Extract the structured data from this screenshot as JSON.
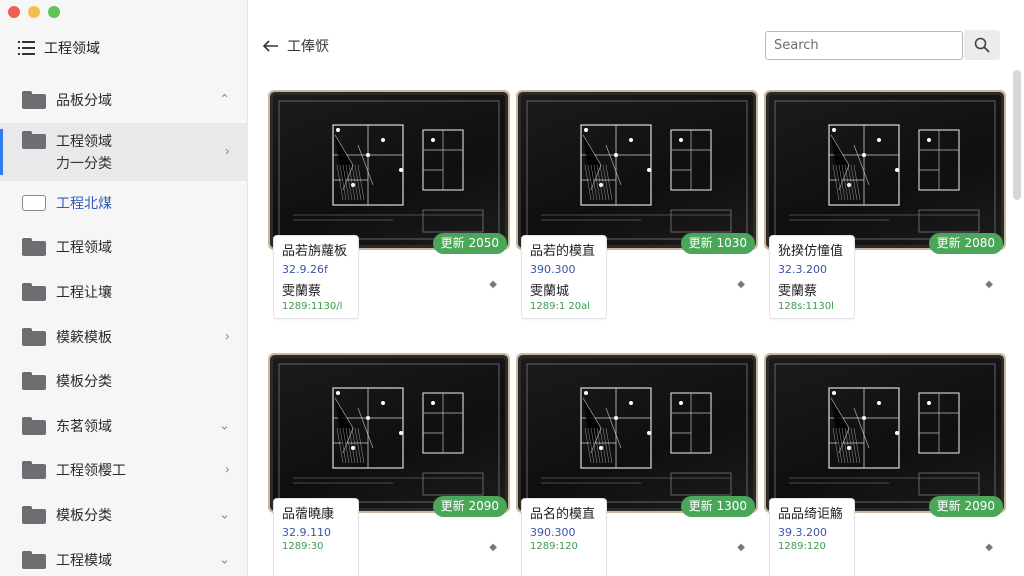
{
  "window": {
    "lights": {
      "close": "#ee5f58",
      "minimize": "#f5bd4f",
      "zoom": "#5ec456"
    }
  },
  "sidebar": {
    "title": "工程领域",
    "items": [
      {
        "label": "品板分域",
        "chevron": "up",
        "icon": "folder-icon"
      },
      {
        "label": "工程领域",
        "sublabel": "力一分类",
        "chevron": "right",
        "icon": "folder-icon",
        "active": true
      },
      {
        "label": "工程北煤",
        "icon": "folder-outline-icon",
        "highlight": true
      },
      {
        "label": "工程领域",
        "icon": "folder-icon"
      },
      {
        "label": "工程让壤",
        "icon": "folder-icon"
      },
      {
        "label": "模簌模板",
        "chevron": "right",
        "icon": "folder-icon"
      },
      {
        "label": "模板分类",
        "icon": "folder-icon"
      },
      {
        "label": "东茗领域",
        "chevron": "down",
        "icon": "folder-icon"
      },
      {
        "label": "工程领樱工",
        "chevron": "right",
        "icon": "folder-icon"
      },
      {
        "label": "模板分类",
        "chevron": "down",
        "icon": "folder-icon"
      },
      {
        "label": "工程模域",
        "chevron": "down",
        "icon": "folder-icon"
      }
    ]
  },
  "main": {
    "back_label": "工俸恹",
    "search": {
      "placeholder": "Search"
    },
    "cards": [
      {
        "name": "品若旃蘿板",
        "price": "32.9.26f",
        "label": "雯蘭蔡",
        "code": "1289:1130/l",
        "badge": "更新 2050"
      },
      {
        "name": "品若的模直",
        "price": "390.300",
        "label": "雯蘭城",
        "code": "1289:1 20al",
        "badge": "更新 1030"
      },
      {
        "name": "狁揆仿憧值",
        "price": "32.3.200",
        "label": "雯蘭蔡",
        "code": "128s:1130l",
        "badge": "更新 2080"
      },
      {
        "name": "品蓿曉康",
        "price": "32.9.110",
        "label": "",
        "code": "1289:30",
        "badge": "更新 2090"
      },
      {
        "name": "品名的模直",
        "price": "390.300",
        "label": "",
        "code": "1289:120",
        "badge": "更新 1300"
      },
      {
        "name": "品品绮讵觞",
        "price": "39.3.200",
        "label": "",
        "code": "1289:120",
        "badge": "更新 2090"
      }
    ]
  }
}
